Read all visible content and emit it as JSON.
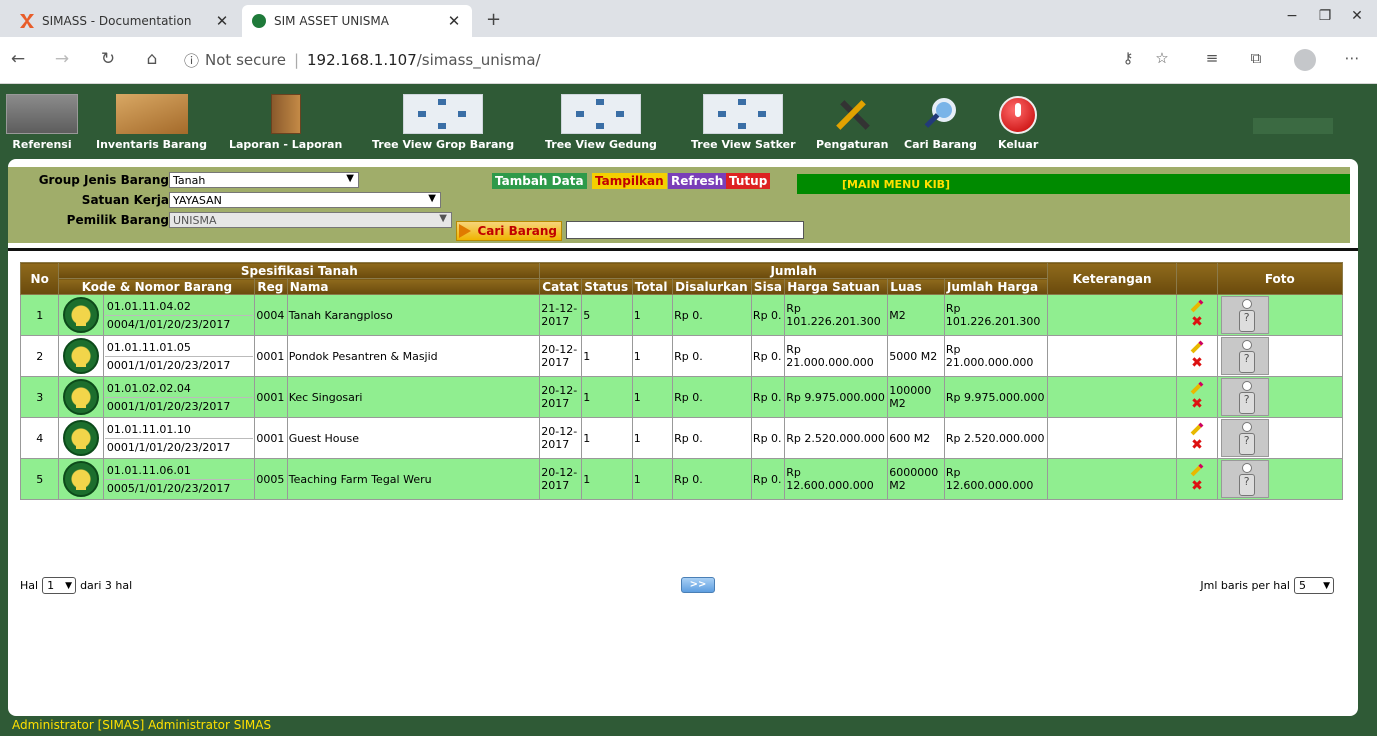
{
  "browser": {
    "tabs": [
      {
        "title": "SIMASS - Documentation"
      },
      {
        "title": "SIM ASSET UNISMA"
      }
    ],
    "new_tab": "+",
    "security_label": "Not secure",
    "separator": "|",
    "url_host": "192.168.1.107",
    "url_path": "/simass_unisma/",
    "window_controls": {
      "minimize": "−",
      "restore": "❐",
      "close": "✕"
    }
  },
  "menu": {
    "items": [
      {
        "label": "Referensi",
        "icon": "building-icon"
      },
      {
        "label": "Inventaris Barang",
        "icon": "boxes-icon"
      },
      {
        "label": "Laporan - Laporan",
        "icon": "cabinet-icon"
      },
      {
        "label": "Tree View Grop Barang",
        "icon": "tree-diagram-icon"
      },
      {
        "label": "Tree View Gedung",
        "icon": "tree-diagram-icon"
      },
      {
        "label": "Tree View Satker",
        "icon": "tree-diagram-icon"
      },
      {
        "label": "Pengaturan",
        "icon": "tools-icon"
      },
      {
        "label": "Cari Barang",
        "icon": "magnifier-icon"
      },
      {
        "label": "Keluar",
        "icon": "power-icon"
      }
    ]
  },
  "filter": {
    "group_label": "Group Jenis Barang",
    "group_value": "Tanah",
    "satker_label": "Satuan Kerja",
    "satker_value": "YAYASAN",
    "pemilik_label": "Pemilik Barang",
    "pemilik_value": "UNISMA",
    "btn_add": "Tambah Data",
    "btn_show": "Tampilkan",
    "btn_refresh": "Refresh",
    "btn_close": "Tutup",
    "main_menu": "[MAIN MENU KIB]",
    "btn_search": "Cari Barang",
    "search_value": ""
  },
  "table": {
    "headers": {
      "no": "No",
      "spesifikasi": "Spesifikasi Tanah",
      "jumlah": "Jumlah",
      "keterangan": "Keterangan",
      "foto": "Foto",
      "kode": "Kode & Nomor Barang",
      "reg": "Reg",
      "nama": "Nama",
      "catat": "Catat",
      "status": "Status",
      "total": "Total",
      "disalurkan": "Disalurkan",
      "sisa": "Sisa",
      "harga_satuan": "Harga Satuan",
      "luas": "Luas",
      "jumlah_harga": "Jumlah Harga"
    },
    "rows": [
      {
        "no": "1",
        "kode": "01.01.11.04.02",
        "nomor": "0004/1/01/20/23/2017",
        "reg": "0004",
        "nama": "Tanah Karangploso",
        "catat": "21-12-2017",
        "status": "5",
        "total": "1",
        "disalurkan": "Rp 0.",
        "sisa": "Rp 0.",
        "harga_satuan": "Rp 101.226.201.300",
        "luas": "M2",
        "jumlah_harga": "Rp 101.226.201.300",
        "keterangan": ""
      },
      {
        "no": "2",
        "kode": "01.01.11.01.05",
        "nomor": "0001/1/01/20/23/2017",
        "reg": "0001",
        "nama": "Pondok Pesantren & Masjid",
        "catat": "20-12-2017",
        "status": "1",
        "total": "1",
        "disalurkan": "Rp 0.",
        "sisa": "Rp 0.",
        "harga_satuan": "Rp 21.000.000.000",
        "luas": "5000 M2",
        "jumlah_harga": "Rp 21.000.000.000",
        "keterangan": ""
      },
      {
        "no": "3",
        "kode": "01.01.02.02.04",
        "nomor": "0001/1/01/20/23/2017",
        "reg": "0001",
        "nama": "Kec Singosari",
        "catat": "20-12-2017",
        "status": "1",
        "total": "1",
        "disalurkan": "Rp 0.",
        "sisa": "Rp 0.",
        "harga_satuan": "Rp 9.975.000.000",
        "luas": "100000 M2",
        "jumlah_harga": "Rp 9.975.000.000",
        "keterangan": ""
      },
      {
        "no": "4",
        "kode": "01.01.11.01.10",
        "nomor": "0001/1/01/20/23/2017",
        "reg": "0001",
        "nama": "Guest House",
        "catat": "20-12-2017",
        "status": "1",
        "total": "1",
        "disalurkan": "Rp 0.",
        "sisa": "Rp 0.",
        "harga_satuan": "Rp 2.520.000.000",
        "luas": "600 M2",
        "jumlah_harga": "Rp 2.520.000.000",
        "keterangan": ""
      },
      {
        "no": "5",
        "kode": "01.01.11.06.01",
        "nomor": "0005/1/01/20/23/2017",
        "reg": "0005",
        "nama": "Teaching Farm Tegal Weru",
        "catat": "20-12-2017",
        "status": "1",
        "total": "1",
        "disalurkan": "Rp 0.",
        "sisa": "Rp 0.",
        "harga_satuan": "Rp 12.600.000.000",
        "luas": "6000000 M2",
        "jumlah_harga": "Rp 12.600.000.000",
        "keterangan": ""
      }
    ]
  },
  "pager": {
    "hal_label": "Hal",
    "hal_value": "1",
    "dari_label": "dari 3 hal",
    "next_label": ">>",
    "per_page_label": "Jml baris per hal",
    "per_page_value": "5"
  },
  "status_bar": "Administrator [SIMAS] Administrator SIMAS",
  "colors": {
    "app_bg": "#2f5a36",
    "row_alt": "#90ee90",
    "header_brown": "#7a5814",
    "filter_bg": "#a0ad6a"
  }
}
